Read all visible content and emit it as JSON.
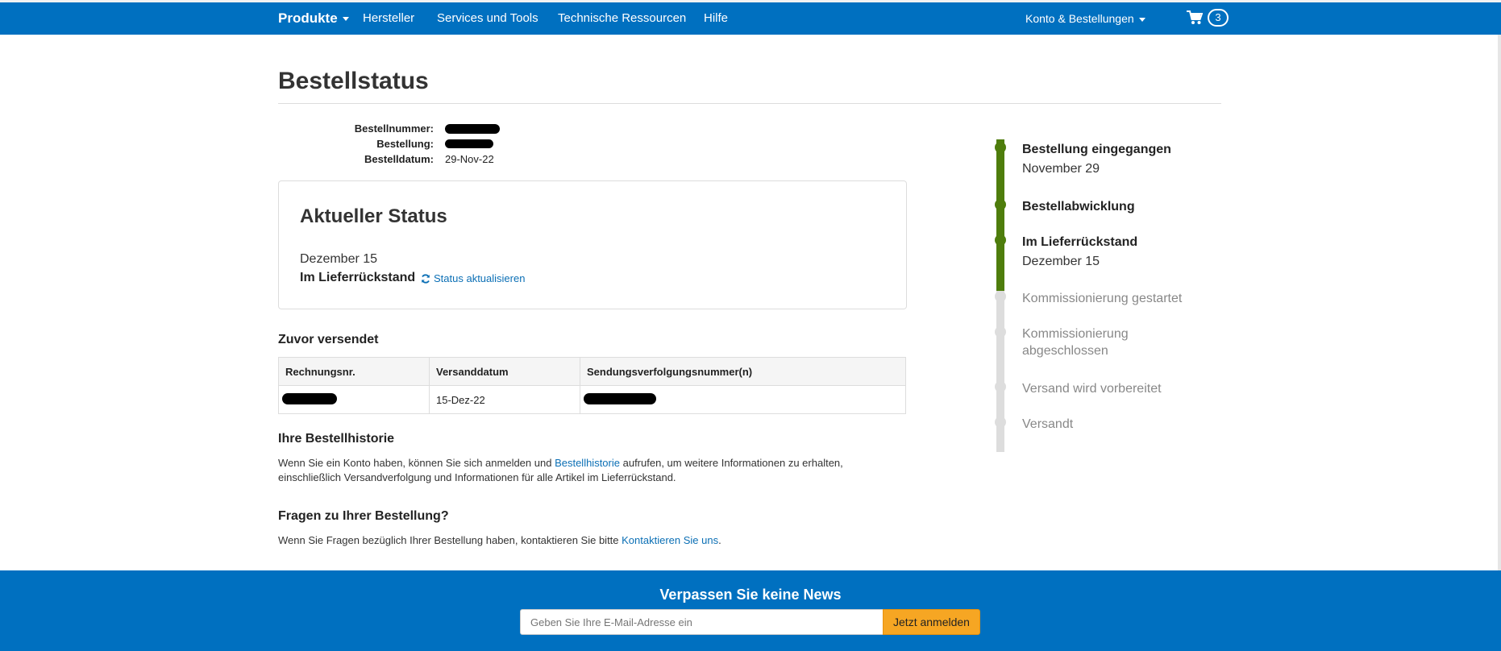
{
  "nav": {
    "brand": "Produkte",
    "items": [
      "Hersteller",
      "Services und Tools",
      "Technische Ressourcen",
      "Hilfe"
    ],
    "account": "Konto & Bestellungen",
    "cart_count": "3"
  },
  "page": {
    "title": "Bestellstatus"
  },
  "order": {
    "number_label": "Bestellnummer:",
    "order_label": "Bestellung:",
    "date_label": "Bestelldatum:",
    "date": "29-Nov-22"
  },
  "status": {
    "heading": "Aktueller Status",
    "date": "Dezember 15",
    "current": "Im Lieferrückstand",
    "refresh": "Status aktualisieren"
  },
  "shipped": {
    "heading": "Zuvor versendet",
    "columns": [
      "Rechnungsnr.",
      "Versanddatum",
      "Sendungsverfolgungsnummer(n)"
    ],
    "row_date": "15-Dez-22"
  },
  "history": {
    "heading": "Ihre Bestellhistorie",
    "text_before": "Wenn Sie ein Konto haben, können Sie sich anmelden und ",
    "link": "Bestellhistorie",
    "text_after": " aufrufen, um weitere Informationen zu erhalten, einschließlich Versandverfolgung und Informationen für alle Artikel im Lieferrückstand."
  },
  "questions": {
    "heading": "Fragen zu Ihrer Bestellung?",
    "text_before": "Wenn Sie Fragen bezüglich Ihrer Bestellung haben, kontaktieren Sie bitte ",
    "link": "Kontaktieren Sie uns",
    "text_after": "."
  },
  "timeline": {
    "steps": [
      {
        "label": "Bestellung eingegangen",
        "date": "November 29",
        "done": true
      },
      {
        "label": "Bestellabwicklung",
        "date": "",
        "done": true
      },
      {
        "label": "Im Lieferrückstand",
        "date": "Dezember 15",
        "done": true
      },
      {
        "label": "Kommissionierung gestartet",
        "date": "",
        "done": false
      },
      {
        "label": "Kommissionierung",
        "label2": "abgeschlossen",
        "date": "",
        "done": false
      },
      {
        "label": "Versand wird vorbereitet",
        "date": "",
        "done": false
      },
      {
        "label": "Versandt",
        "date": "",
        "done": false
      }
    ],
    "done_color": "#4e7d0c",
    "pending_color": "#dddddd"
  },
  "footer": {
    "heading": "Verpassen Sie keine News",
    "email_placeholder": "Geben Sie Ihre E-Mail-Adresse ein",
    "subscribe": "Jetzt anmelden"
  },
  "colors": {
    "brand_blue": "#0070c0",
    "link_blue": "#0b6fb5",
    "button_orange": "#f6a623"
  }
}
